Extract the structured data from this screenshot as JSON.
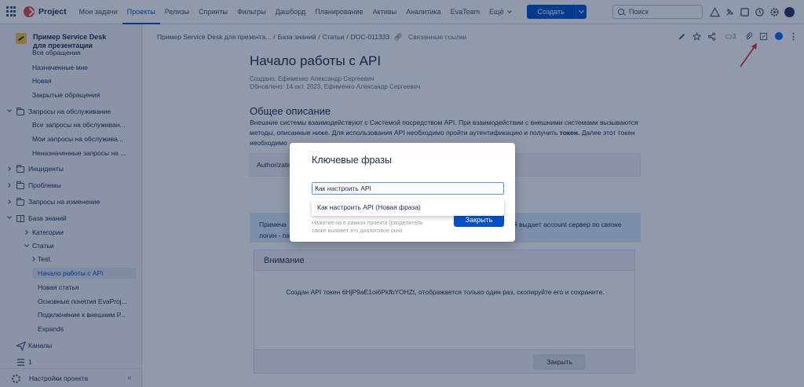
{
  "topnav": {
    "brand": "Project",
    "items": [
      "Мои задачи",
      "Проекты",
      "Релизы",
      "Спринты",
      "Фильтры",
      "Дашборд",
      "Планирование",
      "Активы",
      "Аналитика",
      "EvaTeam"
    ],
    "more": "Ещё",
    "create": "Создать",
    "search_placeholder": "Поиск"
  },
  "sidebar": {
    "project_name": "Пример Service Desk для презентации",
    "items": [
      "Все обращения",
      "Назначенные мне",
      "Новая",
      "Закрытые обращения",
      "Запросы на обслуживание",
      "Все запросы на обслуживан...",
      "Мои запросы на обслужива...",
      "Неназначенные запросы на ...",
      "Инциденты",
      "Проблемы",
      "Запросы на изменение",
      "База знаний",
      "Категории",
      "Статьи",
      "Test.",
      "Начало работы с API",
      "Новая статья",
      "Основные понятия EvaProj...",
      "Подключение к внешним Р...",
      "Expands",
      "Каналы",
      "1"
    ],
    "settings": "Настройки проекта",
    "collapse": "«"
  },
  "breadcrumb": {
    "items": [
      "Пример Service Desk для презента...",
      "База знаний",
      "Статьи",
      "DOC-011333"
    ],
    "linked": "Связанные ссылки"
  },
  "toolbar": {
    "watchers": "3",
    "kebab": "⋮"
  },
  "article": {
    "title": "Начало работы с API",
    "created": "Создано: Ефименко Александр Сергеевич",
    "updated": "Обновлено: 14 окт. 2023, Ефименко Александр Сергеевич",
    "section": "Общее описание",
    "para_1": "Внешние системы взаимодействуют с Системой посредством API. При взаимодействии с внешними системами вызываются методы, описанные ниже. Для использования API необходимо пройти аутентификацию и получить ",
    "para_bold": "токен.",
    "para_2": " Далее этот токен необходимо",
    "code_label": "Authorizatio",
    "note_left_1": "Примеча",
    "note_left_2": "логин - па",
    "note_right_1": "й выдает account сервер по связке"
  },
  "warning": {
    "title": "Внимание",
    "body": "Создан API токен 6HjP9aE1oi6PkfbYOHZt, отображается только один раз, скопируйте его и сохраните.",
    "close": "Закрыть"
  },
  "modal": {
    "title": "Ключевые фразы",
    "input_value": "Как настроить API",
    "clear": "×",
    "suggestion": "Как настроить API (Новая фраза)",
    "hint_1": "Нажатие на в рамках проекта (разделитель",
    "hint_2": "также вызовет это диалоговое окно",
    "close": "Закрыть"
  }
}
